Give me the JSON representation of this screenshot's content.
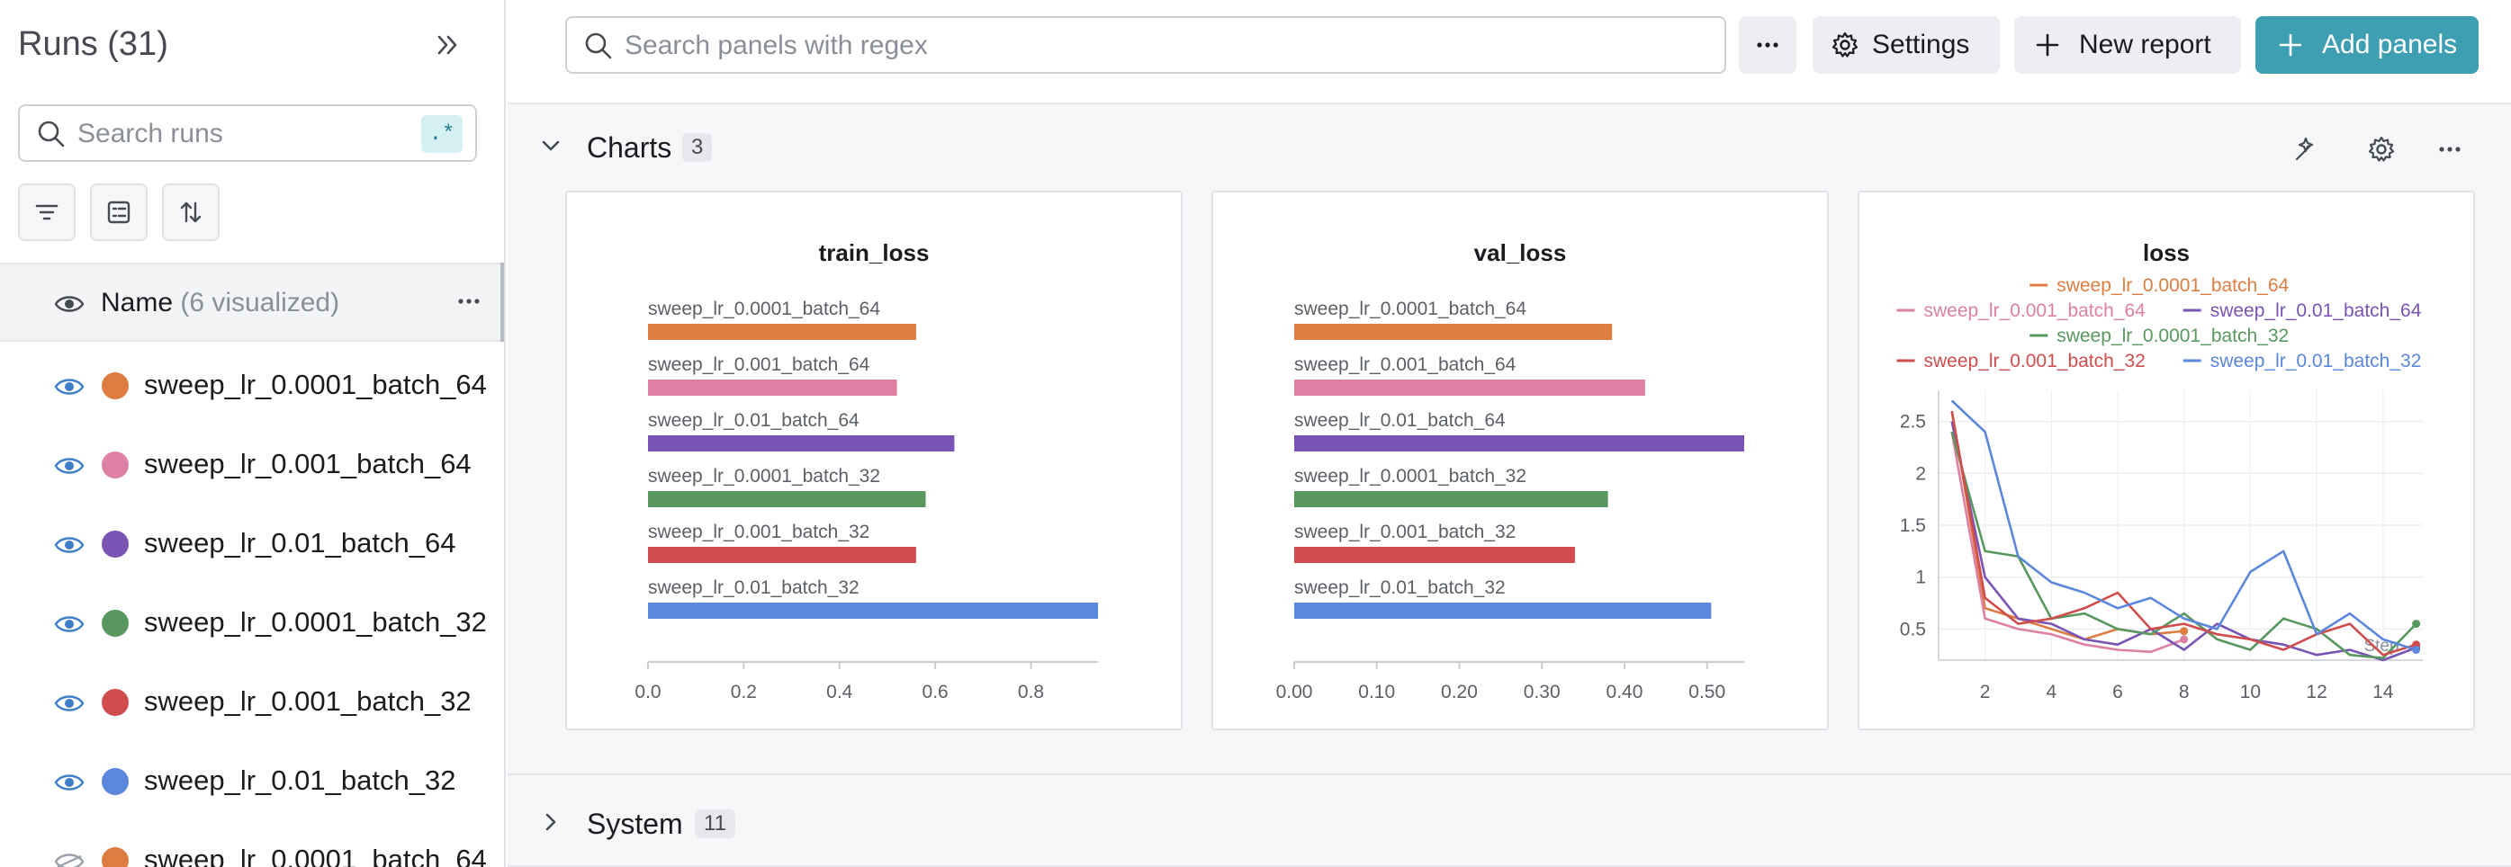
{
  "sidebar": {
    "title": "Runs (31)",
    "search_placeholder": "Search runs",
    "regex_label": ".*",
    "name_header": {
      "label": "Name",
      "note": "(6 visualized)"
    },
    "runs": [
      {
        "name": "sweep_lr_0.0001_batch_64",
        "color": "#dd7d42",
        "visible": true
      },
      {
        "name": "sweep_lr_0.001_batch_64",
        "color": "#de80a3",
        "visible": true
      },
      {
        "name": "sweep_lr_0.01_batch_64",
        "color": "#7954b4",
        "visible": true
      },
      {
        "name": "sweep_lr_0.0001_batch_32",
        "color": "#58985f",
        "visible": true
      },
      {
        "name": "sweep_lr_0.001_batch_32",
        "color": "#d14d4d",
        "visible": true
      },
      {
        "name": "sweep_lr_0.01_batch_32",
        "color": "#5b87dc",
        "visible": true
      },
      {
        "name": "sweep_lr_0.0001_batch_64",
        "color": "#dd7d42",
        "visible": false
      }
    ]
  },
  "topbar": {
    "search_placeholder": "Search panels with regex",
    "settings_label": "Settings",
    "new_report_label": "New report",
    "add_panels_label": "Add panels"
  },
  "sections": {
    "charts": {
      "title": "Charts",
      "count": "3"
    },
    "system": {
      "title": "System",
      "count": "11"
    }
  },
  "chart_data": [
    {
      "type": "bar",
      "title": "train_loss",
      "categories": [
        "sweep_lr_0.0001_batch_64",
        "sweep_lr_0.001_batch_64",
        "sweep_lr_0.01_batch_64",
        "sweep_lr_0.0001_batch_32",
        "sweep_lr_0.001_batch_32",
        "sweep_lr_0.01_batch_32"
      ],
      "values": [
        0.56,
        0.52,
        0.64,
        0.58,
        0.56,
        0.94
      ],
      "colors": [
        "#dd7d42",
        "#de80a3",
        "#7954b4",
        "#58985f",
        "#d14d4d",
        "#5b87dc"
      ],
      "xlim": [
        0,
        0.94
      ],
      "xticks": [
        "0.0",
        "0.2",
        "0.4",
        "0.6",
        "0.8"
      ],
      "xtick_values": [
        0,
        0.2,
        0.4,
        0.6,
        0.8
      ],
      "orientation": "horizontal",
      "grid": false
    },
    {
      "type": "bar",
      "title": "val_loss",
      "categories": [
        "sweep_lr_0.0001_batch_64",
        "sweep_lr_0.001_batch_64",
        "sweep_lr_0.01_batch_64",
        "sweep_lr_0.0001_batch_32",
        "sweep_lr_0.001_batch_32",
        "sweep_lr_0.01_batch_32"
      ],
      "values": [
        0.385,
        0.425,
        0.545,
        0.38,
        0.34,
        0.505
      ],
      "colors": [
        "#dd7d42",
        "#de80a3",
        "#7954b4",
        "#58985f",
        "#d14d4d",
        "#5b87dc"
      ],
      "xlim": [
        0,
        0.545
      ],
      "xticks": [
        "0.00",
        "0.10",
        "0.20",
        "0.30",
        "0.40",
        "0.50"
      ],
      "xtick_values": [
        0,
        0.1,
        0.2,
        0.3,
        0.4,
        0.5
      ],
      "orientation": "horizontal",
      "grid": false
    },
    {
      "type": "line",
      "title": "loss",
      "xlabel": "Step",
      "xlim": [
        0.6,
        15.2
      ],
      "ylim": [
        0.2,
        2.8
      ],
      "xticks": [
        "2",
        "4",
        "6",
        "8",
        "10",
        "12",
        "14"
      ],
      "xtick_values": [
        2,
        4,
        6,
        8,
        10,
        12,
        14
      ],
      "yticks": [
        "0.5",
        "1",
        "1.5",
        "2",
        "2.5"
      ],
      "ytick_values": [
        0.5,
        1,
        1.5,
        2,
        2.5
      ],
      "grid": true,
      "legend": "top",
      "series": [
        {
          "name": "sweep_lr_0.0001_batch_64",
          "color": "#dd7d42",
          "x": [
            1,
            2,
            3,
            4,
            5,
            6,
            7,
            8
          ],
          "y": [
            2.6,
            0.7,
            0.6,
            0.5,
            0.4,
            0.5,
            0.45,
            0.48
          ]
        },
        {
          "name": "sweep_lr_0.001_batch_64",
          "color": "#de80a3",
          "x": [
            1,
            2,
            3,
            4,
            5,
            6,
            7,
            8
          ],
          "y": [
            2.4,
            0.6,
            0.5,
            0.45,
            0.35,
            0.3,
            0.28,
            0.4
          ]
        },
        {
          "name": "sweep_lr_0.01_batch_64",
          "color": "#7954b4",
          "x": [
            1,
            2,
            3,
            4,
            5,
            6,
            7,
            8,
            9,
            10,
            11,
            12,
            13,
            14,
            15
          ],
          "y": [
            2.5,
            1.0,
            0.6,
            0.55,
            0.4,
            0.35,
            0.5,
            0.3,
            0.55,
            0.4,
            0.35,
            0.25,
            0.3,
            0.2,
            0.32
          ]
        },
        {
          "name": "sweep_lr_0.0001_batch_32",
          "color": "#58985f",
          "x": [
            1,
            2,
            3,
            4,
            5,
            6,
            7,
            8,
            9,
            10,
            11,
            12,
            13,
            14,
            15
          ],
          "y": [
            2.4,
            1.25,
            1.2,
            0.6,
            0.65,
            0.5,
            0.45,
            0.65,
            0.4,
            0.3,
            0.6,
            0.5,
            0.25,
            0.22,
            0.55
          ]
        },
        {
          "name": "sweep_lr_0.001_batch_32",
          "color": "#d14d4d",
          "x": [
            1,
            2,
            3,
            4,
            5,
            6,
            7,
            8,
            9,
            10,
            11,
            12,
            13,
            14,
            15
          ],
          "y": [
            2.6,
            0.8,
            0.55,
            0.6,
            0.7,
            0.85,
            0.5,
            0.55,
            0.45,
            0.4,
            0.3,
            0.45,
            0.55,
            0.25,
            0.35
          ]
        },
        {
          "name": "sweep_lr_0.01_batch_32",
          "color": "#5b87dc",
          "x": [
            1,
            2,
            3,
            4,
            5,
            6,
            7,
            8,
            9,
            10,
            11,
            12,
            13,
            14,
            15
          ],
          "y": [
            2.7,
            2.4,
            1.2,
            0.95,
            0.85,
            0.7,
            0.8,
            0.6,
            0.5,
            1.05,
            1.25,
            0.45,
            0.65,
            0.4,
            0.3
          ]
        }
      ]
    }
  ]
}
